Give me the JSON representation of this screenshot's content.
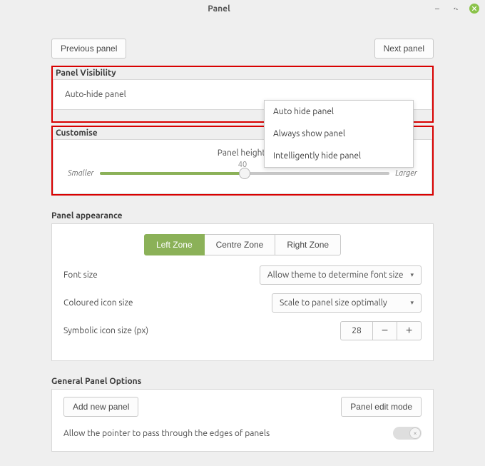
{
  "window": {
    "title": "Panel"
  },
  "nav": {
    "prev": "Previous panel",
    "next": "Next panel"
  },
  "visibility": {
    "header": "Panel Visibility",
    "autohide_label": "Auto-hide panel",
    "options": {
      "auto_hide": "Auto hide panel",
      "always_show": "Always show panel",
      "intelligent": "Intelligently hide panel"
    }
  },
  "customise": {
    "header": "Customise",
    "panel_height_label": "Panel height:",
    "value": "40",
    "smaller": "Smaller",
    "larger": "Larger"
  },
  "appearance": {
    "header": "Panel appearance",
    "zones": {
      "left": "Left Zone",
      "centre": "Centre Zone",
      "right": "Right Zone"
    },
    "font_size_label": "Font size",
    "font_size_value": "Allow theme to determine font size",
    "coloured_icon_label": "Coloured icon size",
    "coloured_icon_value": "Scale to panel size optimally",
    "symbolic_icon_label": "Symbolic icon size (px)",
    "symbolic_icon_value": "28"
  },
  "general": {
    "header": "General Panel Options",
    "add_panel": "Add new panel",
    "edit_mode": "Panel edit mode",
    "pointer_passthrough": "Allow the pointer to pass through the edges of panels"
  }
}
